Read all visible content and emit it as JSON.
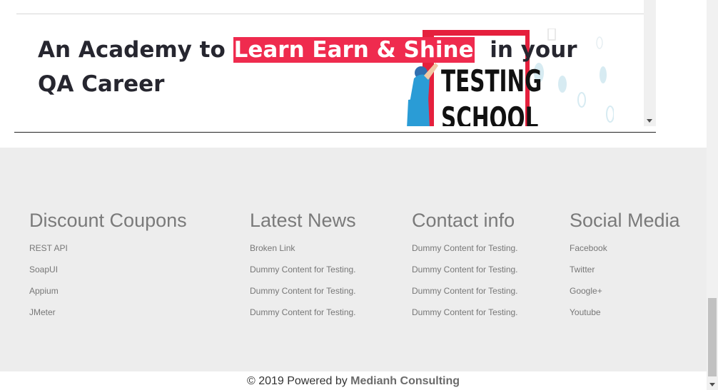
{
  "hero": {
    "title_before": "An Academy to ",
    "title_highlight": "Learn Earn & Shine",
    "title_after": "  in your QA Career",
    "image_sign_line1": "TESTING",
    "image_sign_line2": "SCHOOL"
  },
  "footer": {
    "columns": [
      {
        "heading": "Discount Coupons",
        "links": [
          "REST API",
          "SoapUI",
          "Appium",
          "JMeter"
        ]
      },
      {
        "heading": "Latest News",
        "links": [
          "Broken Link",
          "Dummy Content for Testing.",
          "Dummy Content for Testing.",
          "Dummy Content for Testing."
        ]
      },
      {
        "heading": "Contact info",
        "links": [
          "Dummy Content for Testing.",
          "Dummy Content for Testing.",
          "Dummy Content for Testing.",
          "Dummy Content for Testing."
        ]
      },
      {
        "heading": "Social Media",
        "links": [
          "Facebook",
          "Twitter",
          "Google+",
          "Youtube"
        ]
      }
    ],
    "copyright_prefix": "© 2019 Powered by ",
    "copyright_brand": "Medianh Consulting"
  },
  "colors": {
    "highlight": "#ef2b4e",
    "footer_bg": "#ededed",
    "heading": "#7a7a7a",
    "link": "#777777"
  }
}
